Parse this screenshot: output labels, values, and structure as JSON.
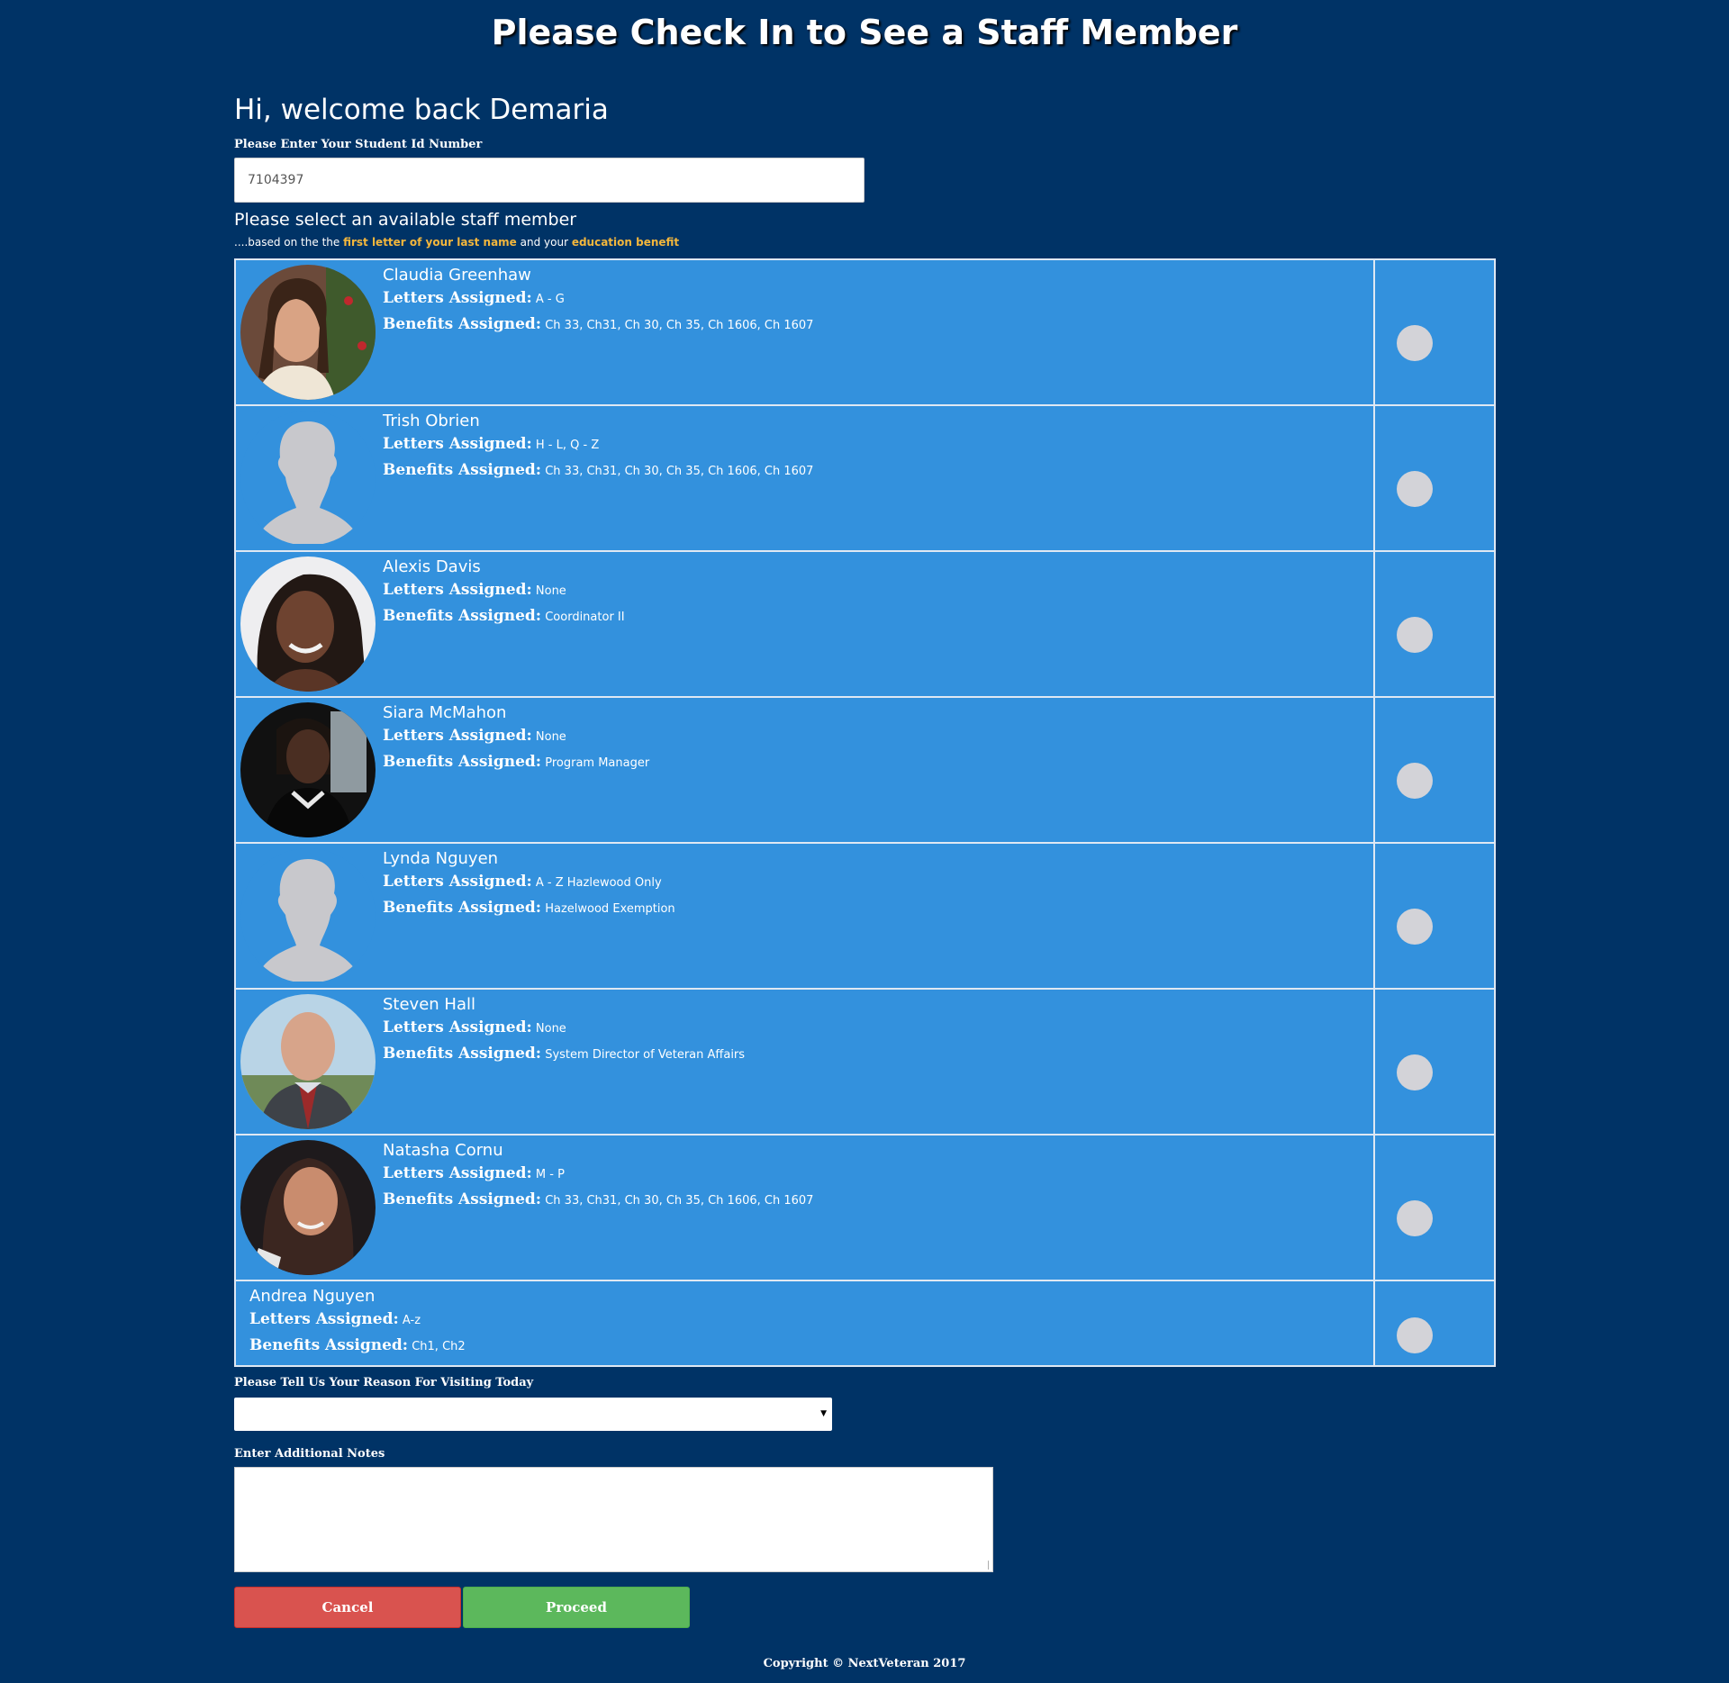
{
  "page_title": "Please Check In to See a Staff Member",
  "welcome_text": "Hi, welcome back Demaria",
  "student_id": {
    "label": "Please Enter Your Student Id Number",
    "value": "7104397"
  },
  "staff_section": {
    "heading": "Please select an available staff member",
    "sub_prefix": "....based on the the ",
    "sub_highlight_1": "first letter of your last name",
    "sub_middle": " and your ",
    "sub_highlight_2": "education benefit",
    "highlight_color": "#f4b73c",
    "letters_label": "Letters Assigned:",
    "benefits_label": "Benefits Assigned:"
  },
  "staff": [
    {
      "name": "Claudia Greenhaw",
      "letters": "A - G",
      "benefits": "Ch 33, Ch31, Ch 30, Ch 35, Ch 1606, Ch 1607",
      "avatar": "photo"
    },
    {
      "name": "Trish Obrien",
      "letters": "H - L, Q - Z",
      "benefits": "Ch 33, Ch31, Ch 30, Ch 35, Ch 1606, Ch 1607",
      "avatar": "silhouette"
    },
    {
      "name": "Alexis Davis",
      "letters": "None",
      "benefits": "Coordinator II",
      "avatar": "photo"
    },
    {
      "name": "Siara McMahon",
      "letters": "None",
      "benefits": "Program Manager",
      "avatar": "photo"
    },
    {
      "name": "Lynda Nguyen",
      "letters": "A - Z Hazlewood Only",
      "benefits": "Hazelwood Exemption",
      "avatar": "silhouette"
    },
    {
      "name": "Steven Hall",
      "letters": "None",
      "benefits": "System Director of Veteran Affairs",
      "avatar": "photo"
    },
    {
      "name": "Natasha Cornu",
      "letters": "M - P",
      "benefits": "Ch 33, Ch31, Ch 30, Ch 35, Ch 1606, Ch 1607",
      "avatar": "photo"
    },
    {
      "name": "Andrea Nguyen",
      "letters": "A-z",
      "benefits": "Ch1, Ch2",
      "avatar": "none"
    }
  ],
  "reason": {
    "label": "Please Tell Us Your Reason For Visiting Today",
    "selected": ""
  },
  "notes": {
    "label": "Enter Additional Notes",
    "value": ""
  },
  "buttons": {
    "cancel": "Cancel",
    "proceed": "Proceed",
    "cancel_color": "#d9534f",
    "proceed_color": "#5cb85c"
  },
  "footer": "Copyright © NextVeteran   2017",
  "colors": {
    "background": "#003366",
    "table_bg": "#3391dd",
    "radio": "#d3d3d8"
  }
}
